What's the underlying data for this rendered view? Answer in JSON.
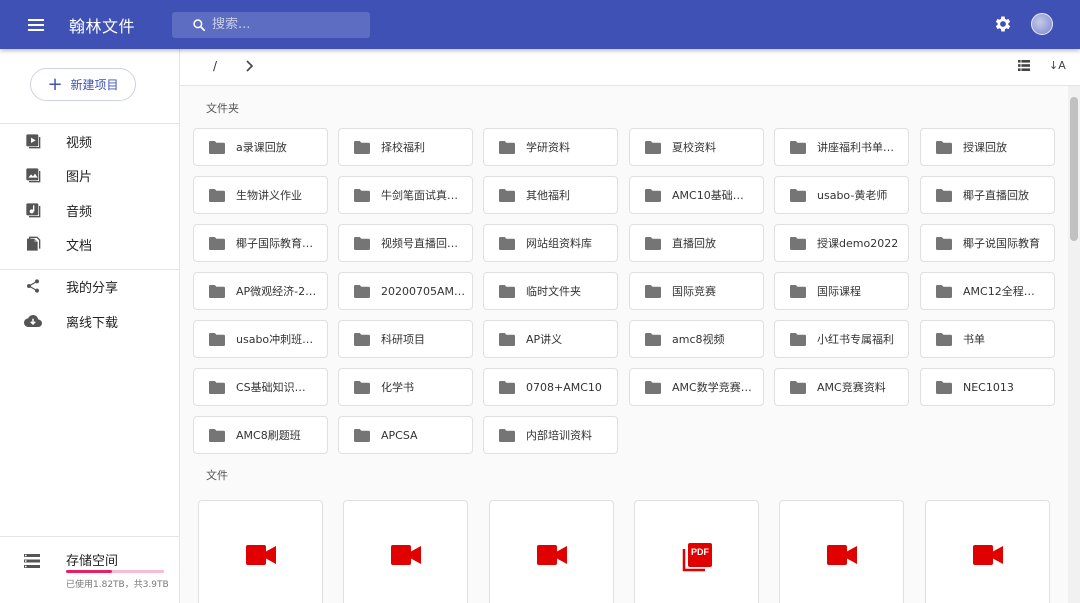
{
  "header": {
    "title": "翰林文件",
    "search_placeholder": "搜索..."
  },
  "sidebar": {
    "new_button": "新建项目",
    "nav": [
      {
        "label": "视频",
        "icon": "video-icon"
      },
      {
        "label": "图片",
        "icon": "image-icon"
      },
      {
        "label": "音频",
        "icon": "audio-icon"
      },
      {
        "label": "文档",
        "icon": "document-icon"
      },
      {
        "label": "我的分享",
        "icon": "share-icon"
      },
      {
        "label": "离线下载",
        "icon": "cloud-download-icon"
      }
    ],
    "storage": {
      "title": "存储空间",
      "info": "已使用1.82TB，共3.9TB",
      "used_fraction": 0.47
    }
  },
  "toolbar": {
    "breadcrumb_root": "/",
    "sort_label": "↓A"
  },
  "main": {
    "folders_title": "文件夹",
    "files_title": "文件",
    "folders": [
      "a录课回放",
      "择校福利",
      "学研资料",
      "夏校资料",
      "讲座福利书单…",
      "授课回放",
      "生物讲义作业",
      "牛剑笔面试真…",
      "其他福利",
      "AMC10基础…",
      "usabo-黄老师",
      "椰子直播回放",
      "椰子国际教育…",
      "视频号直播回…",
      "网站组资料库",
      "直播回放",
      "授课demo2022",
      "椰子说国际教育",
      "AP微观经济-2…",
      "20200705AM…",
      "临时文件夹",
      "国际竞赛",
      "国际课程",
      "AMC12全程…",
      "usabo冲刺班…",
      "科研项目",
      "AP讲义",
      "amc8视频",
      "小红书专属福利",
      "书单",
      "CS基础知识…",
      "化学书",
      "0708+AMC10",
      "AMC数学竞赛…",
      "AMC竞赛资料",
      "NEC1013",
      "AMC8刷题班",
      "APCSA",
      "内部培训资料"
    ],
    "files": [
      {
        "type": "video"
      },
      {
        "type": "video"
      },
      {
        "type": "video"
      },
      {
        "type": "pdf",
        "badge": "PDF"
      },
      {
        "type": "video"
      },
      {
        "type": "video"
      }
    ]
  },
  "colors": {
    "primary": "#3f51b5",
    "video_red": "#e00000",
    "folder_gray": "#757575",
    "storage_pink": "#e91e63"
  }
}
